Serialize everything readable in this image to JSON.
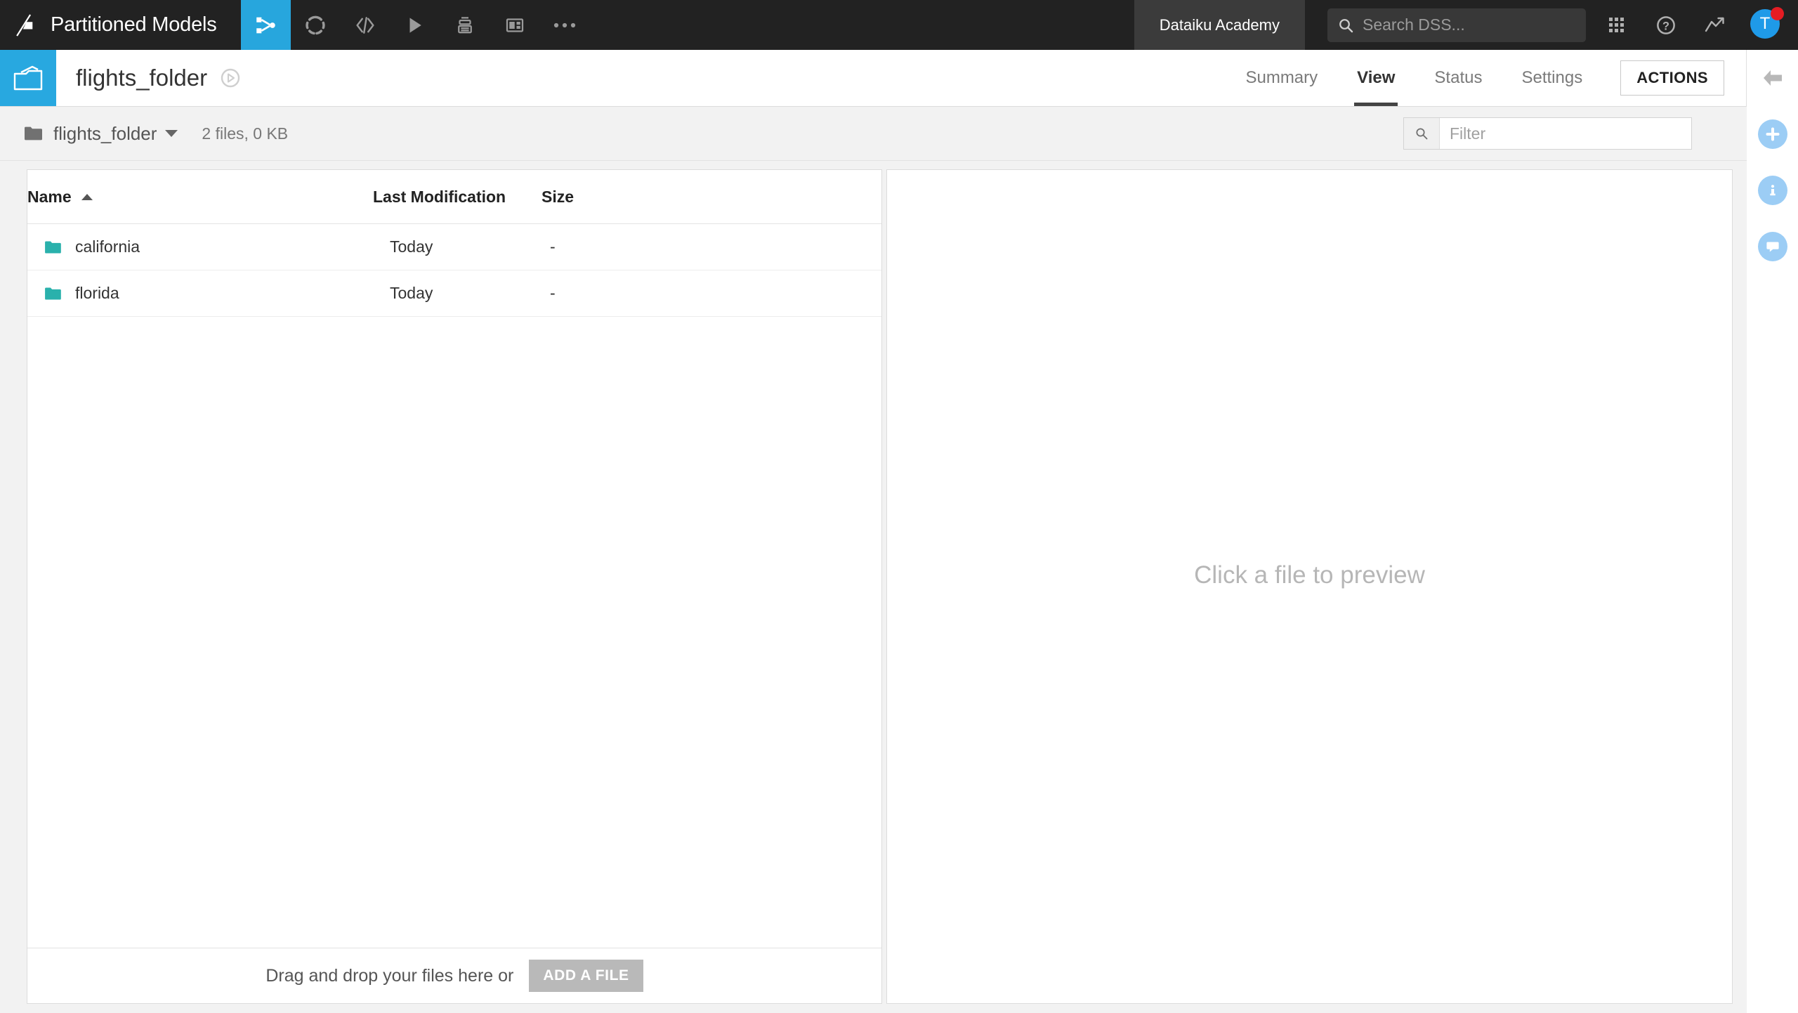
{
  "navbar": {
    "logo_icon": "dataiku-logo-icon",
    "project_name": "Partitioned Models",
    "items": [
      {
        "icon": "flow-icon",
        "label": "Flow",
        "active": true
      },
      {
        "icon": "lab-icon",
        "label": "Lab",
        "active": false
      },
      {
        "icon": "code-icon",
        "label": "Code",
        "active": false
      },
      {
        "icon": "play-icon",
        "label": "Jobs",
        "active": false
      },
      {
        "icon": "stack-icon",
        "label": "Automation",
        "active": false
      },
      {
        "icon": "dashboard-icon",
        "label": "Dashboards",
        "active": false
      },
      {
        "icon": "ellipsis-icon",
        "label": "More",
        "active": false
      }
    ],
    "academy_label": "Dataiku Academy",
    "search": {
      "icon": "search-icon",
      "placeholder": "Search DSS..."
    },
    "apps_icon": "grid-apps-icon",
    "help_icon": "help-icon",
    "activity_icon": "trending-up-icon",
    "avatar": {
      "initial": "T",
      "color": "#1f9ae8",
      "notification_color": "#e51c23"
    }
  },
  "object_header": {
    "icon": "managed-folder-icon",
    "icon_bg": "#28a8e0",
    "title": "flights_folder",
    "badge_icon": "compass-icon",
    "tabs": [
      {
        "label": "Summary",
        "active": false
      },
      {
        "label": "View",
        "active": true
      },
      {
        "label": "Status",
        "active": false
      },
      {
        "label": "Settings",
        "active": false
      }
    ],
    "actions_label": "ACTIONS"
  },
  "right_rail": {
    "items": [
      {
        "icon": "back-arrow-icon",
        "style": "plain"
      },
      {
        "icon": "plus-icon",
        "style": "circle"
      },
      {
        "icon": "info-icon",
        "style": "circle"
      },
      {
        "icon": "comment-icon",
        "style": "circle"
      }
    ],
    "circle_color": "#9ccdf5"
  },
  "toolbar": {
    "breadcrumb_icon": "folder-icon",
    "breadcrumb_name": "flights_folder",
    "stats": "2 files, 0 KB",
    "filter": {
      "icon": "search-icon",
      "placeholder": "Filter",
      "value": ""
    }
  },
  "file_table": {
    "columns": [
      {
        "label": "Name",
        "sorted": true,
        "sort_direction": "asc"
      },
      {
        "label": "Last Modification",
        "sorted": false
      },
      {
        "label": "Size",
        "sorted": false
      }
    ],
    "rows": [
      {
        "icon": "folder-icon",
        "name": "california",
        "last_modification": "Today",
        "size": "-"
      },
      {
        "icon": "folder-icon",
        "name": "florida",
        "last_modification": "Today",
        "size": "-"
      }
    ],
    "folder_icon_color": "#2ab1ac"
  },
  "dropzone": {
    "text": "Drag and drop your files here or",
    "button_label": "ADD A FILE"
  },
  "preview": {
    "empty_message": "Click a file to preview"
  }
}
